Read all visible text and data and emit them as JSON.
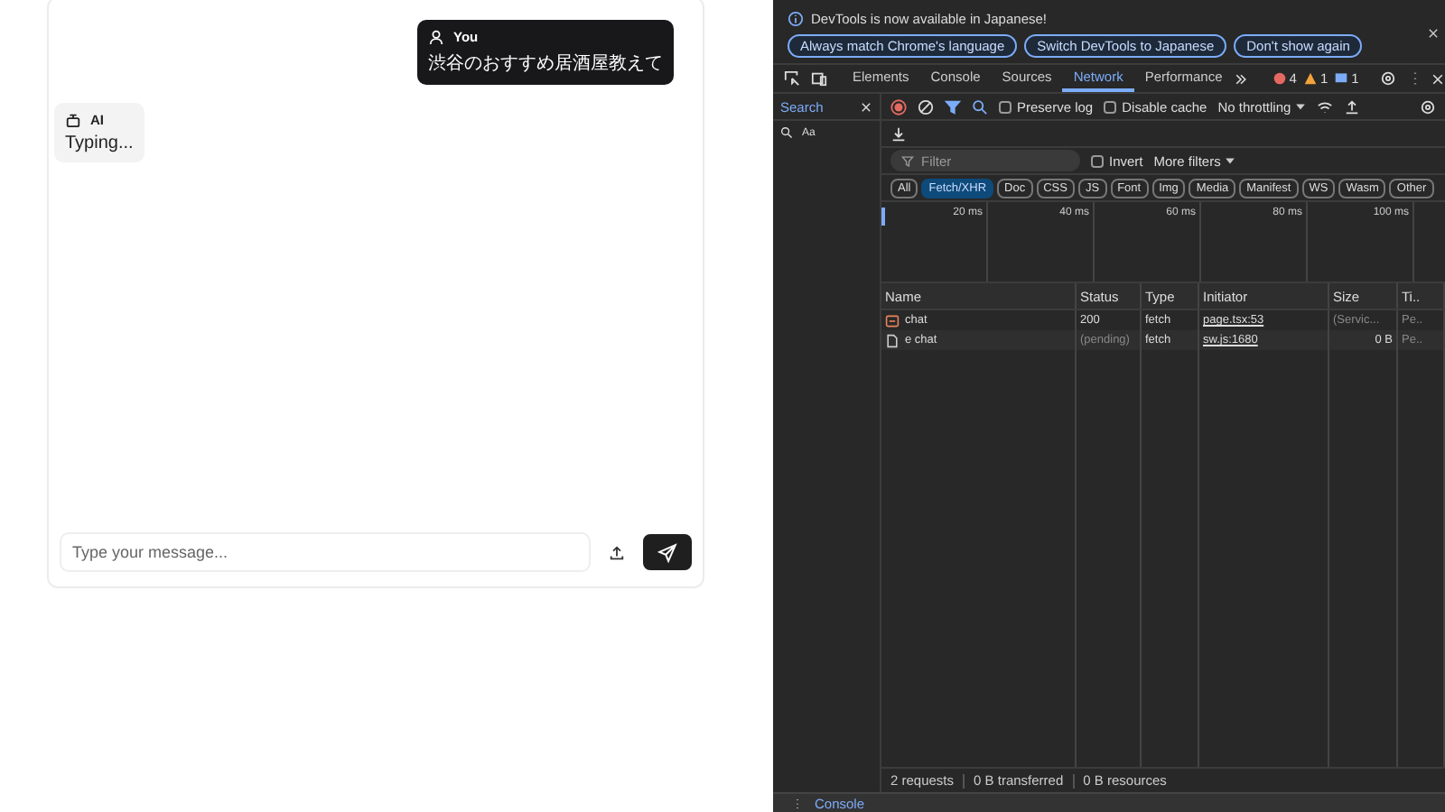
{
  "chat": {
    "messages": [
      {
        "kind": "user",
        "sender": "You",
        "text": "渋谷のおすすめ居酒屋教えて"
      },
      {
        "kind": "ai",
        "sender": "AI",
        "text": "Typing..."
      }
    ],
    "input": {
      "placeholder": "Type your message..."
    }
  },
  "devtools": {
    "notice": {
      "text": "DevTools is now available in Japanese!",
      "buttons": [
        "Always match Chrome's language",
        "Switch DevTools to Japanese",
        "Don't show again"
      ]
    },
    "tabs": [
      {
        "label": "Elements",
        "selected": false
      },
      {
        "label": "Console",
        "selected": false
      },
      {
        "label": "Sources",
        "selected": false
      },
      {
        "label": "Network",
        "selected": true
      },
      {
        "label": "Performance",
        "selected": false
      }
    ],
    "counts": {
      "errors": "4",
      "warnings": "1",
      "messages": "1"
    },
    "search_panel": {
      "title": "Search",
      "options": [
        "Aa"
      ]
    },
    "toolbar": {
      "recording": true,
      "preserve_log": {
        "label": "Preserve log",
        "checked": false
      },
      "disable_cache": {
        "label": "Disable cache",
        "checked": false
      },
      "throttling": "No throttling"
    },
    "filter": {
      "placeholder": "Filter",
      "invert": {
        "label": "Invert",
        "checked": false
      },
      "more_filters": "More filters"
    },
    "type_filters": [
      {
        "label": "All",
        "selected": false
      },
      {
        "label": "Fetch/XHR",
        "selected": true
      },
      {
        "label": "Doc",
        "selected": false
      },
      {
        "label": "CSS",
        "selected": false
      },
      {
        "label": "JS",
        "selected": false
      },
      {
        "label": "Font",
        "selected": false
      },
      {
        "label": "Img",
        "selected": false
      },
      {
        "label": "Media",
        "selected": false
      },
      {
        "label": "Manifest",
        "selected": false
      },
      {
        "label": "WS",
        "selected": false
      },
      {
        "label": "Wasm",
        "selected": false
      },
      {
        "label": "Other",
        "selected": false
      }
    ],
    "timeline_ticks": [
      "20 ms",
      "40 ms",
      "60 ms",
      "80 ms",
      "100 ms"
    ],
    "columns": [
      "Name",
      "Status",
      "Type",
      "Initiator",
      "Size",
      "Ti.."
    ],
    "rows": [
      {
        "kind": "fetch",
        "name": "chat",
        "status": "200",
        "type": "fetch",
        "initiator": "page.tsx:53",
        "size": "(Servic...",
        "time": "Pe.."
      },
      {
        "kind": "pending",
        "name": "e chat",
        "status": "(pending)",
        "type": "fetch",
        "initiator": "sw.js:1680",
        "size": "0 B",
        "time": "Pe.."
      }
    ],
    "summary": [
      "2 requests",
      "0 B transferred",
      "0 B resources"
    ],
    "drawer": {
      "tab": "Console"
    }
  }
}
